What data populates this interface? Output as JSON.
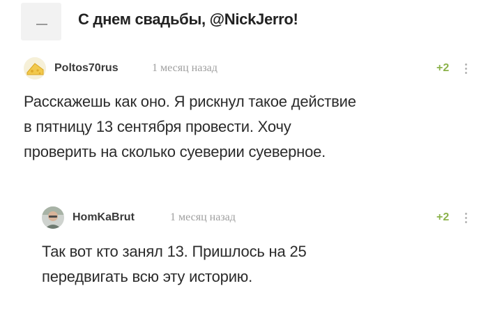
{
  "post": {
    "title": "С днем свадьбы, @NickJerro!"
  },
  "comments": [
    {
      "username": "Poltos70rus",
      "time": "1 месяц назад",
      "rating": "+2",
      "lines": [
        "Расскажешь как оно. Я рискнул такое действие",
        "в пятницу 13 сентября провести. Хочу",
        "проверить на сколько суеверии суеверное."
      ]
    },
    {
      "username": "HomKaBrut",
      "time": "1 месяц назад",
      "rating": "+2",
      "lines": [
        "Так вот кто занял 13. Пришлось на 25",
        "передвигать всю эту историю."
      ]
    }
  ],
  "colors": {
    "rating": "#8bb24a",
    "time": "#9f9f9f"
  },
  "icons": {
    "collapse": "minus-icon",
    "more": "vertical-dots-icon"
  }
}
